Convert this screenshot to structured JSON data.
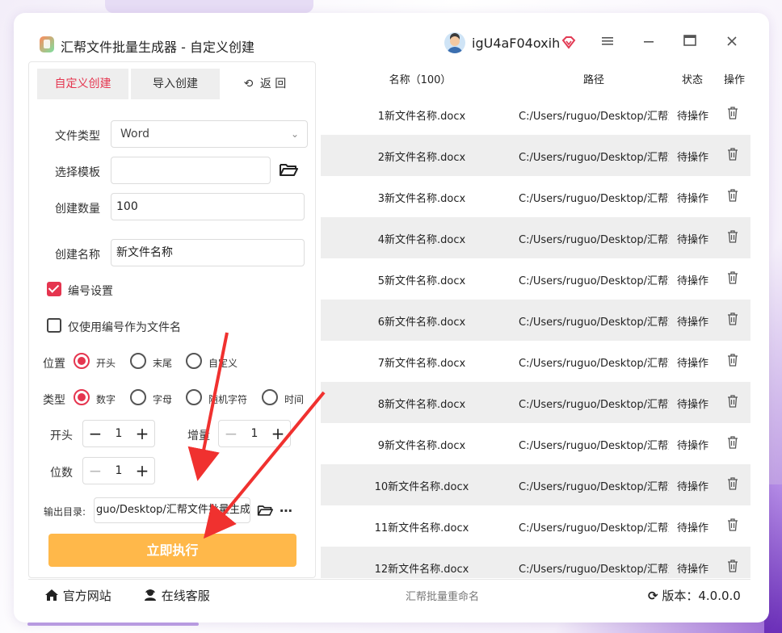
{
  "app": {
    "title": "汇帮文件批量生成器 - 自定义创建",
    "username": "igU4aF04oxih"
  },
  "tabs": {
    "custom": "自定义创建",
    "import": "导入创建",
    "back": "返 回"
  },
  "form": {
    "file_type_label": "文件类型",
    "file_type_value": "Word",
    "template_label": "选择模板",
    "template_value": "",
    "count_label": "创建数量",
    "count_value": "100",
    "name_label": "创建名称",
    "name_value": "新文件名称",
    "numbering_label": "编号设置",
    "numbering_checked": true,
    "only_number_label": "仅使用编号作为文件名",
    "only_number_checked": false,
    "position_label": "位置",
    "position_options": [
      "开头",
      "末尾",
      "自定义"
    ],
    "position_selected": "开头",
    "type_label": "类型",
    "type_options": [
      "数字",
      "字母",
      "随机字符",
      "时间"
    ],
    "type_selected": "数字",
    "start_label": "开头",
    "start_value": "1",
    "increment_label": "增量",
    "increment_value": "1",
    "digits_label": "位数",
    "digits_value": "1",
    "output_label": "输出目录:",
    "output_value": "guo/Desktop/汇帮文件批量生成器",
    "execute_label": "立即执行"
  },
  "table": {
    "headers": {
      "name": "名称（100）",
      "path": "路径",
      "status": "状态",
      "action": "操作"
    },
    "rows": [
      {
        "name": "1新文件名称.docx",
        "path": "C:/Users/ruguo/Desktop/汇帮文",
        "status": "待操作"
      },
      {
        "name": "2新文件名称.docx",
        "path": "C:/Users/ruguo/Desktop/汇帮文",
        "status": "待操作"
      },
      {
        "name": "3新文件名称.docx",
        "path": "C:/Users/ruguo/Desktop/汇帮文",
        "status": "待操作"
      },
      {
        "name": "4新文件名称.docx",
        "path": "C:/Users/ruguo/Desktop/汇帮文",
        "status": "待操作"
      },
      {
        "name": "5新文件名称.docx",
        "path": "C:/Users/ruguo/Desktop/汇帮文",
        "status": "待操作"
      },
      {
        "name": "6新文件名称.docx",
        "path": "C:/Users/ruguo/Desktop/汇帮文",
        "status": "待操作"
      },
      {
        "name": "7新文件名称.docx",
        "path": "C:/Users/ruguo/Desktop/汇帮文",
        "status": "待操作"
      },
      {
        "name": "8新文件名称.docx",
        "path": "C:/Users/ruguo/Desktop/汇帮文",
        "status": "待操作"
      },
      {
        "name": "9新文件名称.docx",
        "path": "C:/Users/ruguo/Desktop/汇帮文",
        "status": "待操作"
      },
      {
        "name": "10新文件名称.docx",
        "path": "C:/Users/ruguo/Desktop/汇帮文",
        "status": "待操作"
      },
      {
        "name": "11新文件名称.docx",
        "path": "C:/Users/ruguo/Desktop/汇帮文",
        "status": "待操作"
      },
      {
        "name": "12新文件名称.docx",
        "path": "C:/Users/ruguo/Desktop/汇帮文",
        "status": "待操作"
      }
    ]
  },
  "footer": {
    "website": "官方网站",
    "support": "在线客服",
    "center": "汇帮批量重命名",
    "version": "版本：4.0.0.0"
  },
  "colors": {
    "accent": "#e5354f",
    "execute": "#ffb84a",
    "row_alt": "#eeeeee"
  }
}
